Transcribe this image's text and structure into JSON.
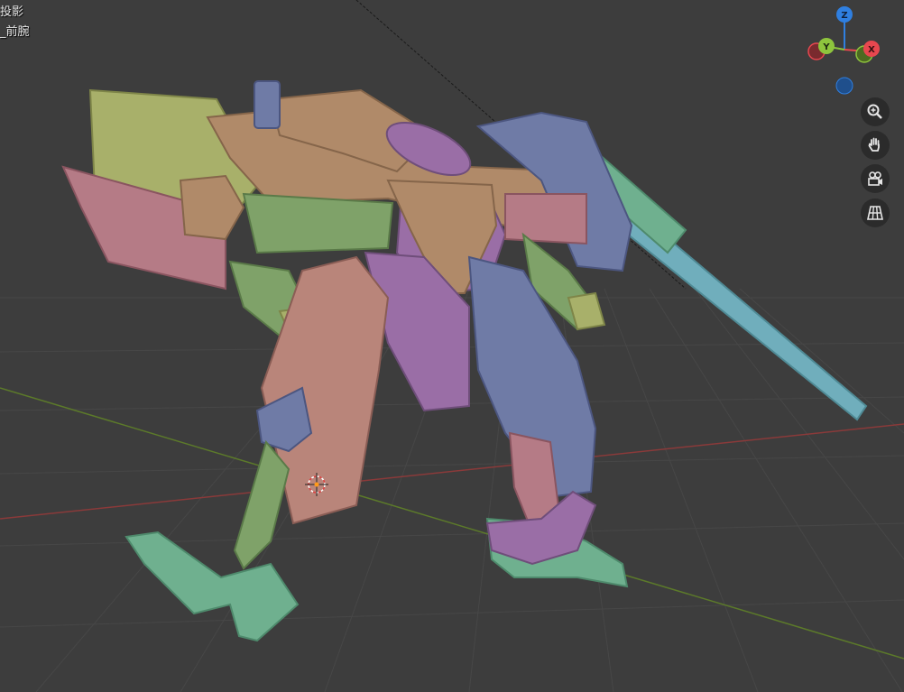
{
  "viewport": {
    "view_mode": "投影",
    "active_object": "_前腕",
    "background_color": "#3d3d3d"
  },
  "gizmo": {
    "z_label": "Z",
    "y_label": "Y",
    "x_label": "X",
    "x_color": "#e8474f",
    "y_color": "#8ec43d",
    "z_color": "#2f7fe0"
  },
  "nav_buttons": [
    {
      "name": "zoom",
      "icon": "zoom-icon"
    },
    {
      "name": "pan",
      "icon": "hand-icon"
    },
    {
      "name": "camera",
      "icon": "camera-icon"
    },
    {
      "name": "ortho",
      "icon": "grid-icon"
    }
  ],
  "model_colors": {
    "tan": "#b08a69",
    "olive": "#a8b06a",
    "green": "#7fa269",
    "pink": "#b57b86",
    "salmon": "#b9857a",
    "purple": "#9a6ea6",
    "blue": "#6f7ba6",
    "teal": "#70aebc",
    "mint": "#6fb08f"
  }
}
